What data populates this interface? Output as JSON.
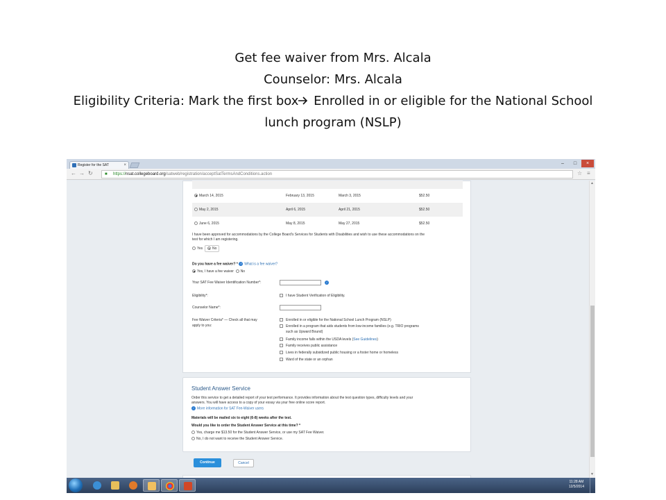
{
  "caption": {
    "line1": "Get fee waiver from Mrs. Alcala",
    "line2": "Counselor: Mrs. Alcala",
    "line3_a": "Eligibility Criteria: Mark the first box",
    "line3_b": " Enrolled in or eligible for the National School",
    "line4": "lunch program (NSLP)"
  },
  "browser": {
    "tab_title": "Register for the SAT",
    "url_https": "https://",
    "url_domain": "nsat.collegeboard.org",
    "url_path": "/satweb/registration/acceptSatTermsAndConditions.action"
  },
  "test_dates": [
    {
      "date": "March 14, 2015",
      "deadline": "February 13, 2015",
      "late": "March 3, 2015",
      "fee": "$52.50",
      "selected": true
    },
    {
      "date": "May 2, 2015",
      "deadline": "April 6, 2015",
      "late": "April 21, 2015",
      "fee": "$52.50",
      "selected": false
    },
    {
      "date": "June 6, 2015",
      "deadline": "May 8, 2015",
      "late": "May 27, 2015",
      "fee": "$52.50",
      "selected": false
    }
  ],
  "accommodations": {
    "text1": "I have been approved for accommodations by the College Board's Services for Students with Disabilities and wish to use these accommodations on the",
    "text2": "test for which I am registering.",
    "yes": "Yes",
    "no": "No"
  },
  "fee_waiver": {
    "question": "Do you have a fee waiver? *",
    "what_link": "What is a fee waiver?",
    "yes": "Yes, I have a fee waiver",
    "no": "No",
    "id_label": "Your SAT Fee Waiver Identification Number*:",
    "elig_label": "Eligibility*:",
    "elig_option": "I have Student Verification of Eligibility.",
    "counselor_label": "Counselor Name*:",
    "criteria_label_1": "Fee Waiver Criteria* — Check all that may",
    "criteria_label_2": "apply to you:",
    "criteria": [
      "Enrolled in or eligible for the National School Lunch Program (NSLP)",
      "Enrolled in a program that aids students from low-income families (e.g. TRIO programs",
      "Family income falls within the USDA levels (",
      "Family receives public assistance",
      "Lives in federally subsidized public housing or a foster home or homeless",
      "Ward of the state or an orphan"
    ],
    "criteria_cont": "such as Upward Bound)",
    "see_guidelines": "See Guidelines",
    "close_paren": ")"
  },
  "sas": {
    "heading": "Student Answer Service",
    "p1": "Order this service to get a detailed report of your test performance. It provides information about the test question types, difficulty levels and your",
    "p2": "answers. You will have access to a copy of your essay via your free online score report.",
    "more_link": "More information for SAT Fee-Waiver users",
    "mailed": "Materials will be mailed six to eight (6-8) weeks after the test.",
    "question": "Would you like to order the Student Answer Service at this time? *",
    "opt_yes": "Yes, charge me $13.50 for the Student Answer Service, or use my SAT Fee Waiver.",
    "opt_no": "No, I do not want to receive the Student Answer Service."
  },
  "buttons": {
    "continue": "Continue",
    "cancel": "Cancel"
  },
  "taskbar": {
    "time": "11:28 AM",
    "date": "12/5/2014"
  },
  "colors": {
    "accent": "#2a8fdb",
    "link": "#2b6fb3",
    "heading": "#2b5a8a"
  }
}
